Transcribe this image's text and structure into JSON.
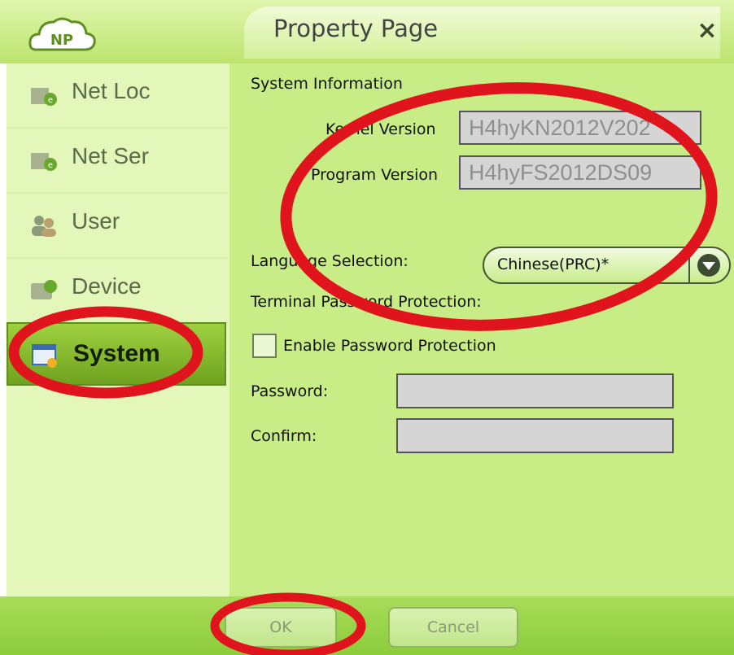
{
  "window": {
    "title": "Property Page",
    "logo_text": "NP",
    "close_glyph": "×"
  },
  "sidebar": {
    "items": [
      {
        "label": "Net Loc",
        "icon": "net-loc-icon"
      },
      {
        "label": "Net Ser",
        "icon": "net-ser-icon"
      },
      {
        "label": "User",
        "icon": "user-icon"
      },
      {
        "label": "Device",
        "icon": "device-icon"
      },
      {
        "label": "System",
        "icon": "system-icon",
        "active": true
      }
    ]
  },
  "content": {
    "section_title": "System Information",
    "kernel_label": "Kernel Version",
    "kernel_value": "H4hyKN2012V202",
    "program_label": "Program Version",
    "program_value": "H4hyFS2012DS09",
    "language_label": "Language Selection:",
    "language_value": "Chinese(PRC)*",
    "terminal_label": "Terminal Password Protection:",
    "enable_label": "Enable Password Protection",
    "enable_checked": false,
    "password_label": "Password:",
    "password_value": "",
    "confirm_label": "Confirm:",
    "confirm_value": ""
  },
  "footer": {
    "ok_label": "OK",
    "cancel_label": "Cancel"
  },
  "colors": {
    "annotation": "#e0141c",
    "accent": "#7db52c",
    "panel": "#c8ec86"
  }
}
